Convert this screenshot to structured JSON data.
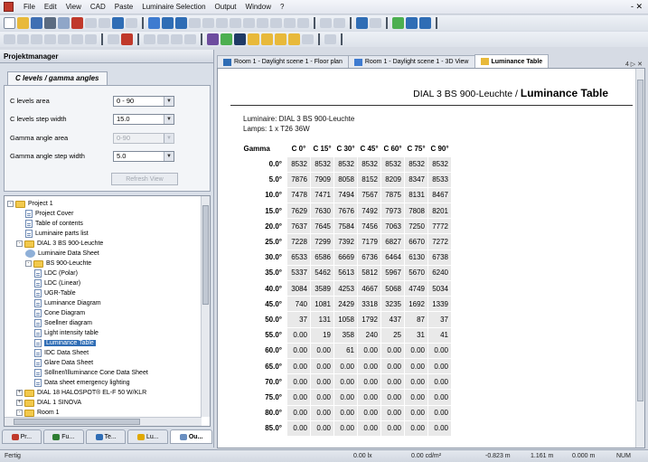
{
  "menu": [
    "File",
    "Edit",
    "View",
    "CAD",
    "Paste",
    "Luminaire Selection",
    "Output",
    "Window",
    "?"
  ],
  "window_control": "- ✕",
  "panel": {
    "title": "Projektmanager",
    "tab": "C levels / gamma angles",
    "rows": [
      {
        "label": "C levels area",
        "value": "0 - 90",
        "enabled": true
      },
      {
        "label": "C levels step width",
        "value": "15.0",
        "enabled": true
      },
      {
        "label": "Gamma angle area",
        "value": "0-90",
        "enabled": false
      },
      {
        "label": "Gamma angle step width",
        "value": "5.0",
        "enabled": true
      }
    ],
    "refresh_label": "Refresh View"
  },
  "tree": [
    {
      "label": "Project 1",
      "icon": "folder-icon",
      "expander": "-",
      "level": 0
    },
    {
      "label": "Project Cover",
      "icon": "doc-icon",
      "level": 2
    },
    {
      "label": "Table of contents",
      "icon": "doc-icon",
      "level": 2
    },
    {
      "label": "Luminaire parts list",
      "icon": "doc-icon",
      "level": 2
    },
    {
      "label": "DIAL 3 BS 900-Leuchte",
      "icon": "folder-icon",
      "expander": "-",
      "level": 1
    },
    {
      "label": "Luminaire Data Sheet",
      "icon": "luminaire-icon",
      "level": 2
    },
    {
      "label": "BS 900-Leuchte",
      "icon": "folder-icon",
      "expander": "-",
      "level": 2
    },
    {
      "label": "LDC (Polar)",
      "icon": "doc-icon",
      "level": 3
    },
    {
      "label": "LDC (Linear)",
      "icon": "doc-icon",
      "level": 3
    },
    {
      "label": "UGR-Table",
      "icon": "doc-icon",
      "level": 3
    },
    {
      "label": "Luminance Diagram",
      "icon": "doc-icon",
      "level": 3
    },
    {
      "label": "Cone Diagram",
      "icon": "doc-icon",
      "level": 3
    },
    {
      "label": "Soellner diagram",
      "icon": "doc-icon",
      "level": 3
    },
    {
      "label": "Light intensity table",
      "icon": "doc-icon",
      "level": 3
    },
    {
      "label": "Luminance Table",
      "icon": "doc-icon",
      "level": 3,
      "selected": true
    },
    {
      "label": "IDC Data Sheet",
      "icon": "doc-icon",
      "level": 3
    },
    {
      "label": "Glare Data Sheet",
      "icon": "doc-icon",
      "level": 3
    },
    {
      "label": "Söllner/Illuminance Cone Data Sheet",
      "icon": "doc-icon",
      "level": 3
    },
    {
      "label": "Data sheet emergency lighting",
      "icon": "doc-icon",
      "level": 3
    },
    {
      "label": "DIAL 18 HALOSPOT® EL-F 50 W/KLR",
      "icon": "folder-icon",
      "expander": "+",
      "level": 1
    },
    {
      "label": "DIAL 1 SINOVA",
      "icon": "folder-icon",
      "expander": "+",
      "level": 1
    },
    {
      "label": "Room 1",
      "icon": "folder-icon",
      "expander": "-",
      "level": 1
    }
  ],
  "bottom_tabs": [
    {
      "label": "Pr...",
      "color": "#c0392b",
      "active": false
    },
    {
      "label": "Fu...",
      "color": "#2e7d32",
      "active": false
    },
    {
      "label": "Te...",
      "color": "#2f6db5",
      "active": false
    },
    {
      "label": "Lu...",
      "color": "#e0a800",
      "active": false
    },
    {
      "label": "Ou...",
      "color": "#6a8fc0",
      "active": true
    }
  ],
  "doc_tabs": [
    {
      "label": "Room 1 - Daylight scene 1 - Floor plan",
      "active": false
    },
    {
      "label": "Room 1 - Daylight scene 1 - 3D View",
      "active": false
    },
    {
      "label": "Luminance Table",
      "active": true
    }
  ],
  "doc_nav": "4 ▷ ✕",
  "document": {
    "title_part1": "DIAL 3 BS 900-Leuchte / ",
    "title_part2": "Luminance Table",
    "luminaire_line": "Luminaire: DIAL 3 BS 900-Leuchte",
    "lamps_line": "Lamps: 1 x T26 36W",
    "table": {
      "header_gamma": "Gamma",
      "columns": [
        "C 0°",
        "C 15°",
        "C 30°",
        "C 45°",
        "C 60°",
        "C 75°",
        "C 90°"
      ],
      "rows": [
        {
          "gamma": "0.0°",
          "values": [
            "8532",
            "8532",
            "8532",
            "8532",
            "8532",
            "8532",
            "8532"
          ]
        },
        {
          "gamma": "5.0°",
          "values": [
            "7876",
            "7909",
            "8058",
            "8152",
            "8209",
            "8347",
            "8533"
          ]
        },
        {
          "gamma": "10.0°",
          "values": [
            "7478",
            "7471",
            "7494",
            "7567",
            "7875",
            "8131",
            "8467"
          ]
        },
        {
          "gamma": "15.0°",
          "values": [
            "7629",
            "7630",
            "7676",
            "7492",
            "7973",
            "7808",
            "8201"
          ]
        },
        {
          "gamma": "20.0°",
          "values": [
            "7637",
            "7645",
            "7584",
            "7456",
            "7063",
            "7250",
            "7772"
          ]
        },
        {
          "gamma": "25.0°",
          "values": [
            "7228",
            "7299",
            "7392",
            "7179",
            "6827",
            "6670",
            "7272"
          ]
        },
        {
          "gamma": "30.0°",
          "values": [
            "6533",
            "6586",
            "6669",
            "6736",
            "6464",
            "6130",
            "6738"
          ]
        },
        {
          "gamma": "35.0°",
          "values": [
            "5337",
            "5462",
            "5613",
            "5812",
            "5967",
            "5670",
            "6240"
          ]
        },
        {
          "gamma": "40.0°",
          "values": [
            "3084",
            "3589",
            "4253",
            "4667",
            "5068",
            "4749",
            "5034"
          ]
        },
        {
          "gamma": "45.0°",
          "values": [
            "740",
            "1081",
            "2429",
            "3318",
            "3235",
            "1692",
            "1339"
          ]
        },
        {
          "gamma": "50.0°",
          "values": [
            "37",
            "131",
            "1058",
            "1792",
            "437",
            "87",
            "37"
          ]
        },
        {
          "gamma": "55.0°",
          "values": [
            "0.00",
            "19",
            "358",
            "240",
            "25",
            "31",
            "41"
          ]
        },
        {
          "gamma": "60.0°",
          "values": [
            "0.00",
            "0.00",
            "61",
            "0.00",
            "0.00",
            "0.00",
            "0.00"
          ]
        },
        {
          "gamma": "65.0°",
          "values": [
            "0.00",
            "0.00",
            "0.00",
            "0.00",
            "0.00",
            "0.00",
            "0.00"
          ]
        },
        {
          "gamma": "70.0°",
          "values": [
            "0.00",
            "0.00",
            "0.00",
            "0.00",
            "0.00",
            "0.00",
            "0.00"
          ]
        },
        {
          "gamma": "75.0°",
          "values": [
            "0.00",
            "0.00",
            "0.00",
            "0.00",
            "0.00",
            "0.00",
            "0.00"
          ]
        },
        {
          "gamma": "80.0°",
          "values": [
            "0.00",
            "0.00",
            "0.00",
            "0.00",
            "0.00",
            "0.00",
            "0.00"
          ]
        },
        {
          "gamma": "85.0°",
          "values": [
            "0.00",
            "0.00",
            "0.00",
            "0.00",
            "0.00",
            "0.00",
            "0.00"
          ]
        }
      ]
    }
  },
  "status": {
    "left": "Fertig",
    "illuminance": "0.00 lx",
    "luminance": "0.00 cd/m²",
    "x": "-0.823 m",
    "y": "1.161 m",
    "z": "0.000 m",
    "num": "NUM"
  },
  "colors": {
    "selection": "#2f6db5",
    "table_cell": "#e9e9e9",
    "folder": "#f2c94c"
  }
}
